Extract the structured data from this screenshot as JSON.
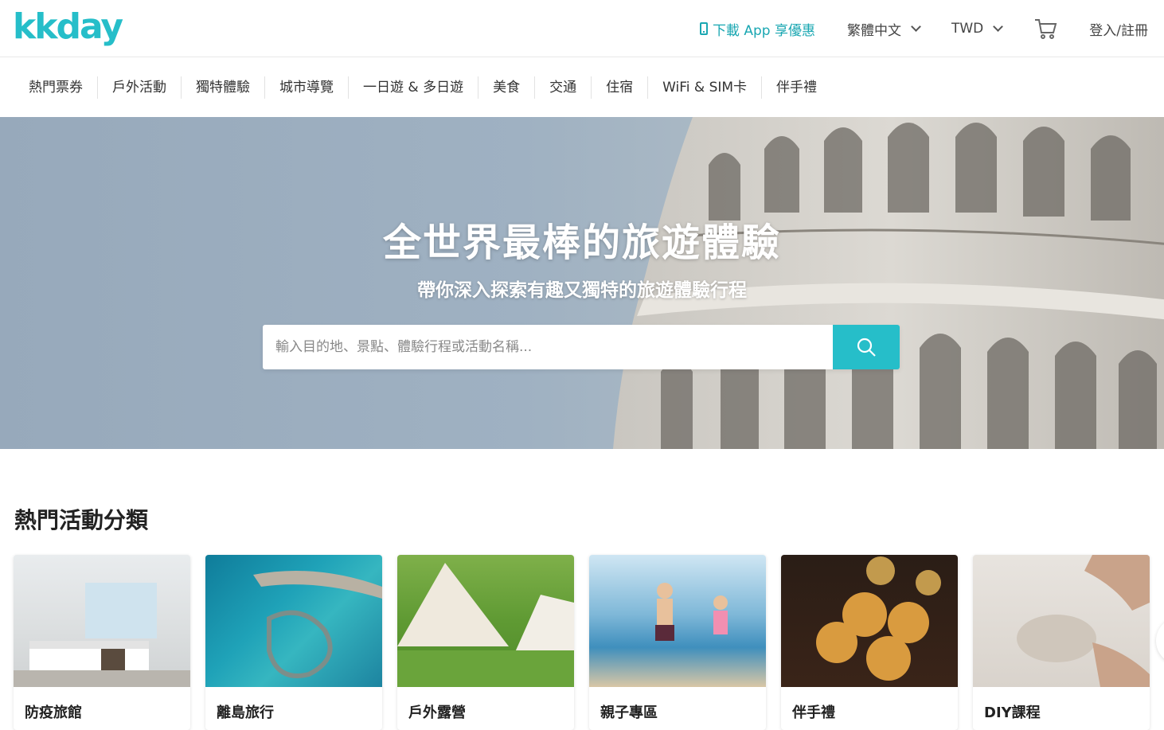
{
  "header": {
    "logo": "kkday",
    "app_download": "下載 App 享優惠",
    "language": "繁體中文",
    "currency": "TWD",
    "login": "登入/註冊"
  },
  "categories": [
    "熱門票券",
    "戶外活動",
    "獨特體驗",
    "城市導覽",
    "一日遊 & 多日遊",
    "美食",
    "交通",
    "住宿",
    "WiFi & SIM卡",
    "伴手禮"
  ],
  "hero": {
    "title": "全世界最棒的旅遊體驗",
    "subtitle": "帶你深入探索有趣又獨特的旅遊體驗行程",
    "search_placeholder": "輸入目的地、景點、體驗行程或活動名稱..."
  },
  "popular": {
    "title": "熱門活動分類",
    "cards": [
      {
        "label": "防疫旅館"
      },
      {
        "label": "離島旅行"
      },
      {
        "label": "戶外露營"
      },
      {
        "label": "親子專區"
      },
      {
        "label": "伴手禮"
      },
      {
        "label": "DIY課程"
      }
    ]
  },
  "colors": {
    "brand": "#26bec9"
  }
}
